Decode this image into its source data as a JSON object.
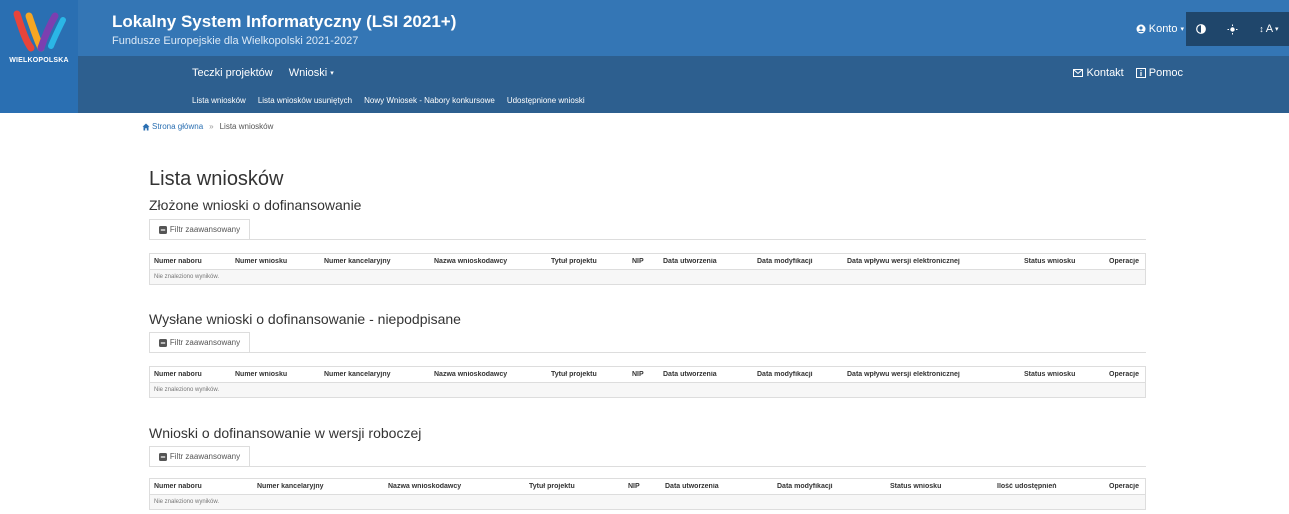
{
  "brand": {
    "logo_text": "WIELKOPOLSKA"
  },
  "header": {
    "title": "Lokalny System Informatyczny (LSI 2021+)",
    "subtitle": "Fundusze Europejskie dla Wielkopolski 2021-2027",
    "account_label": "Konto",
    "font_size_label": "A"
  },
  "nav": {
    "primary": [
      {
        "label": "Teczki projektów"
      },
      {
        "label": "Wnioski"
      }
    ],
    "right": [
      {
        "label": "Kontakt"
      },
      {
        "label": "Pomoc"
      }
    ],
    "secondary": [
      {
        "label": "Lista wniosków"
      },
      {
        "label": "Lista wniosków usuniętych"
      },
      {
        "label": "Nowy Wniosek - Nabory konkursowe"
      },
      {
        "label": "Udostępnione wnioski"
      }
    ]
  },
  "breadcrumb": {
    "home": "Strona główna",
    "current": "Lista wniosków"
  },
  "page_title": "Lista wniosków",
  "filter_label": "Filtr zaawansowany",
  "empty_text": "Nie znaleziono wyników.",
  "sections": [
    {
      "title": "Złożone wnioski o dofinansowanie",
      "columns": [
        "Numer naboru",
        "Numer wniosku",
        "Numer kancelaryjny",
        "Nazwa wnioskodawcy",
        "Tytuł projektu",
        "NIP",
        "Data utworzenia",
        "Data modyfikacji",
        "Data wpływu wersji elektronicznej",
        "Status wniosku",
        "Operacje"
      ]
    },
    {
      "title": "Wysłane wnioski o dofinansowanie - niepodpisane",
      "columns": [
        "Numer naboru",
        "Numer wniosku",
        "Numer kancelaryjny",
        "Nazwa wnioskodawcy",
        "Tytuł projektu",
        "NIP",
        "Data utworzenia",
        "Data modyfikacji",
        "Data wpływu wersji elektronicznej",
        "Status wniosku",
        "Operacje"
      ]
    },
    {
      "title": "Wnioski o dofinansowanie w wersji roboczej",
      "columns": [
        "Numer naboru",
        "Numer kancelaryjny",
        "Nazwa wnioskodawcy",
        "Tytuł projektu",
        "NIP",
        "Data utworzenia",
        "Data modyfikacji",
        "Status wniosku",
        "Ilość udostępnień",
        "Operacje"
      ]
    }
  ],
  "colors": {
    "header_dark": "#2d5f8f",
    "header_light": "#3476b5",
    "tools_bg": "#1f466b",
    "link": "#2a6fb2"
  }
}
